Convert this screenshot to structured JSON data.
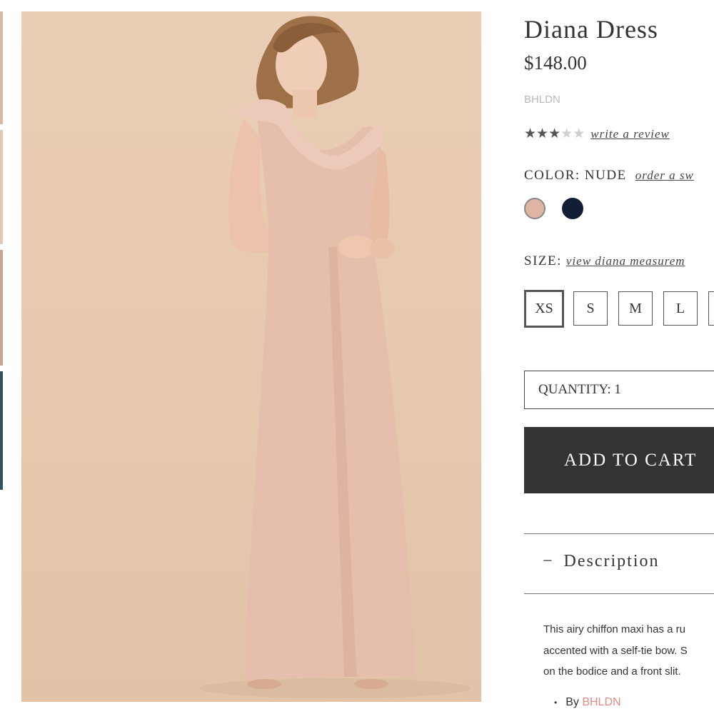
{
  "product": {
    "title": "Diana Dress",
    "price": "$148.00",
    "brand": "BHLDN",
    "rating": 3,
    "rating_max": 5,
    "write_review": "write a review"
  },
  "color": {
    "label": "COLOR: NUDE",
    "swatch_link": "order a sw",
    "swatches": [
      {
        "name": "nude",
        "hex": "#dfb4a3",
        "selected": true
      },
      {
        "name": "navy",
        "hex": "#131d33",
        "selected": false
      }
    ]
  },
  "size": {
    "label": "SIZE:",
    "link": "view diana measurem",
    "options": [
      "XS",
      "S",
      "M",
      "L"
    ],
    "selected": "XS"
  },
  "quantity": {
    "label": "QUANTITY: 1"
  },
  "cart": {
    "button_label": "ADD TO CART"
  },
  "description": {
    "heading": "Description",
    "minus_glyph": "−",
    "lines": [
      "This airy chiffon maxi has a ru",
      "accented with a self-tie bow. S",
      "on the bodice and a front slit."
    ],
    "by_prefix": "By",
    "by_brand": "BHLDN"
  },
  "colors": {
    "button_bg": "#333333",
    "brand_link": "#e08c84",
    "photo_bg": "#e6c8ad"
  }
}
